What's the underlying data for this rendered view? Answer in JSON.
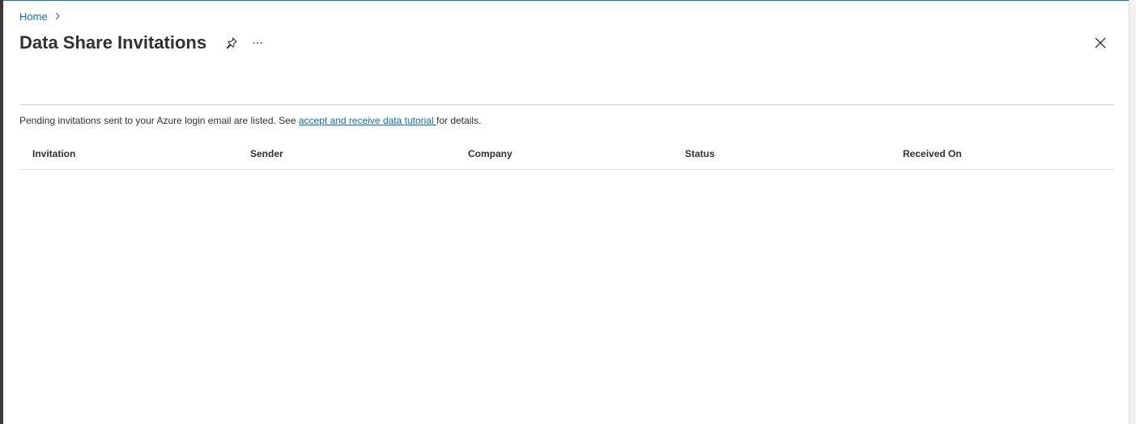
{
  "breadcrumb": {
    "home_label": "Home"
  },
  "page": {
    "title": "Data Share Invitations",
    "pin_icon": "pin-icon",
    "more_icon": "ellipsis-icon",
    "close_icon": "close-icon"
  },
  "info": {
    "prefix": "Pending invitations sent to your Azure login email are listed. See ",
    "link_label": "accept and receive data tutorial ",
    "suffix": "for details."
  },
  "table": {
    "columns": [
      "Invitation",
      "Sender",
      "Company",
      "Status",
      "Received On"
    ],
    "rows": []
  },
  "colors": {
    "link": "#0f6cbd",
    "text": "#323130",
    "divider": "#d2d0ce"
  }
}
